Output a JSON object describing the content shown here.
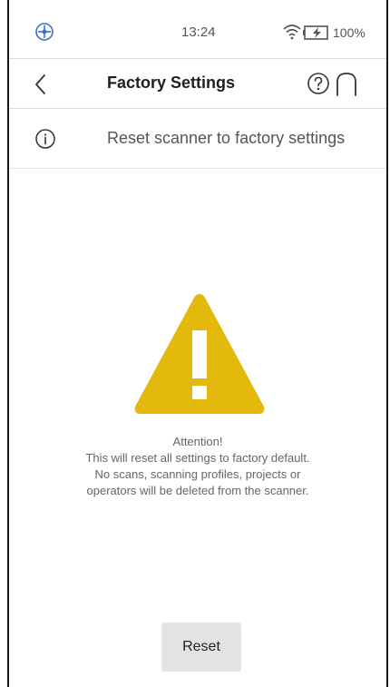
{
  "status_bar": {
    "time": "13:24",
    "battery": "100%",
    "app_icon": "scanner-logo-icon",
    "wifi_icon": "wifi-icon",
    "battery_icon": "battery-charging-icon"
  },
  "header": {
    "title": "Factory Settings",
    "back_icon": "chevron-left-icon",
    "help_icon": "help-circle-icon",
    "home_icon": "home-icon"
  },
  "info": {
    "text": "Reset scanner to factory settings",
    "icon": "info-icon"
  },
  "warning": {
    "icon": "warning-triangle-icon",
    "color": "#e3b90b",
    "line1": "Attention!",
    "line2": "This will reset all settings to factory default.",
    "line3": "No scans, scanning profiles, projects or",
    "line4": "operators will be deleted from the scanner."
  },
  "actions": {
    "reset_label": "Reset"
  }
}
